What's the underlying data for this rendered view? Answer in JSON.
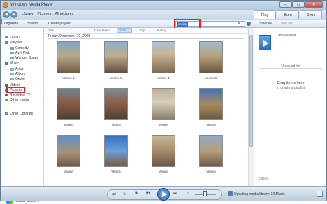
{
  "window": {
    "title": "Windows Media Player"
  },
  "nav": {
    "crumbs": [
      "Library",
      "Pictures",
      "All pictures"
    ]
  },
  "tabs": [
    {
      "label": "Play"
    },
    {
      "label": "Burn"
    },
    {
      "label": "Sync"
    }
  ],
  "toolbar": {
    "organize": "Organize",
    "stream": "Stream",
    "create_playlist": "Create playlist"
  },
  "search": {
    "value": "venice"
  },
  "right_toolbar": {
    "save_list": "Save list",
    "clear_list": "Clear list"
  },
  "sidebar": {
    "items": [
      {
        "label": "Library"
      },
      {
        "label": "Playlists"
      },
      {
        "label": "Comedy"
      },
      {
        "label": "Avril Pink"
      },
      {
        "label": "Wonder Songs"
      },
      {
        "label": "Music"
      },
      {
        "label": "Artist"
      },
      {
        "label": "Album"
      },
      {
        "label": "Genre"
      },
      {
        "label": "Videos"
      },
      {
        "label": "Pictures"
      },
      {
        "label": "Recorded TV"
      },
      {
        "label": "Other media"
      },
      {
        "label": "Other Libraries"
      }
    ],
    "media_guide": "Media Guide"
  },
  "columns": {
    "title": "Title",
    "date_taken": "Date taken",
    "size": "Size",
    "tags": "Tags",
    "rating": "Rating"
  },
  "group_header": "Friday, December 10, 2008",
  "photos": [
    {
      "caption": "Venice 1"
    },
    {
      "caption": "Venice 3"
    },
    {
      "caption": "Venice 4"
    },
    {
      "caption": "Venice 5"
    },
    {
      "caption": "Venice"
    },
    {
      "caption": "Venice"
    },
    {
      "caption": "Venice"
    },
    {
      "caption": "Venice"
    },
    {
      "caption": "Venice"
    },
    {
      "caption": "Venice"
    },
    {
      "caption": "Venice"
    },
    {
      "caption": "Venice"
    }
  ],
  "playlist_pane": {
    "title": "Unsaved list",
    "list_label": "Unsaved list",
    "drag_title": "Drag items here",
    "drag_sub": "to create a playlist",
    "items_label": "0 items"
  },
  "status": {
    "text": "Updating media library: 3/5Music"
  }
}
